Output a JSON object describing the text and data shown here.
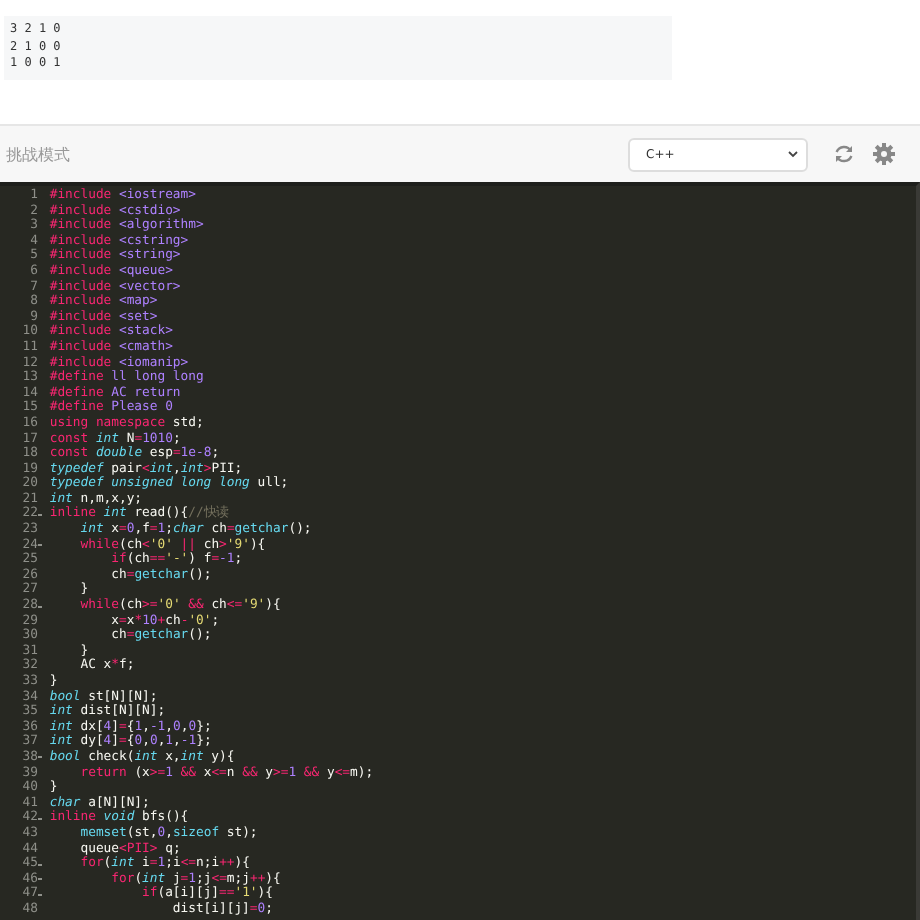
{
  "sample_output": [
    "3 2 1 0",
    "2 1 0 0",
    "1 0 0 1"
  ],
  "toolbar": {
    "mode_label": "挑战模式",
    "language": "C++"
  },
  "editor": {
    "lines": [
      {
        "n": "1",
        "foldable": false,
        "tokens": [
          {
            "kind": "keyword",
            "text": "#include"
          },
          {
            "kind": "literal",
            "text": " <iostream>"
          }
        ]
      },
      {
        "n": "2",
        "foldable": false,
        "tokens": [
          {
            "kind": "keyword",
            "text": "#include"
          },
          {
            "kind": "literal",
            "text": " <cstdio>"
          }
        ]
      },
      {
        "n": "3",
        "foldable": false,
        "tokens": [
          {
            "kind": "keyword",
            "text": "#include"
          },
          {
            "kind": "literal",
            "text": " <algorithm>"
          }
        ]
      },
      {
        "n": "4",
        "foldable": false,
        "tokens": [
          {
            "kind": "keyword",
            "text": "#include"
          },
          {
            "kind": "literal",
            "text": " <cstring>"
          }
        ]
      },
      {
        "n": "5",
        "foldable": false,
        "tokens": [
          {
            "kind": "keyword",
            "text": "#include"
          },
          {
            "kind": "literal",
            "text": " <string>"
          }
        ]
      },
      {
        "n": "6",
        "foldable": false,
        "tokens": [
          {
            "kind": "keyword",
            "text": "#include"
          },
          {
            "kind": "literal",
            "text": " <queue>"
          }
        ]
      },
      {
        "n": "7",
        "foldable": false,
        "tokens": [
          {
            "kind": "keyword",
            "text": "#include"
          },
          {
            "kind": "literal",
            "text": " <vector>"
          }
        ]
      },
      {
        "n": "8",
        "foldable": false,
        "tokens": [
          {
            "kind": "keyword",
            "text": "#include"
          },
          {
            "kind": "literal",
            "text": " <map>"
          }
        ]
      },
      {
        "n": "9",
        "foldable": false,
        "tokens": [
          {
            "kind": "keyword",
            "text": "#include"
          },
          {
            "kind": "literal",
            "text": " <set>"
          }
        ]
      },
      {
        "n": "10",
        "foldable": false,
        "tokens": [
          {
            "kind": "keyword",
            "text": "#include"
          },
          {
            "kind": "literal",
            "text": " <stack>"
          }
        ]
      },
      {
        "n": "11",
        "foldable": false,
        "tokens": [
          {
            "kind": "keyword",
            "text": "#include"
          },
          {
            "kind": "literal",
            "text": " <cmath>"
          }
        ]
      },
      {
        "n": "12",
        "foldable": false,
        "tokens": [
          {
            "kind": "keyword",
            "text": "#include"
          },
          {
            "kind": "literal",
            "text": " <iomanip>"
          }
        ]
      },
      {
        "n": "13",
        "foldable": false,
        "tokens": [
          {
            "kind": "keyword",
            "text": "#define"
          },
          {
            "kind": "macro",
            "text": " ll long long"
          }
        ]
      },
      {
        "n": "14",
        "foldable": false,
        "tokens": [
          {
            "kind": "keyword",
            "text": "#define"
          },
          {
            "kind": "macro",
            "text": " AC return"
          }
        ]
      },
      {
        "n": "15",
        "foldable": false,
        "tokens": [
          {
            "kind": "keyword",
            "text": "#define"
          },
          {
            "kind": "macro",
            "text": " Please 0"
          }
        ]
      },
      {
        "n": "16",
        "foldable": false,
        "tokens": [
          {
            "kind": "keyword",
            "text": "using namespace"
          },
          {
            "kind": "plain",
            "text": " std;"
          }
        ]
      },
      {
        "n": "17",
        "foldable": false,
        "tokens": [
          {
            "kind": "keyword",
            "text": "const"
          },
          {
            "kind": "type",
            "text": " int"
          },
          {
            "kind": "plain",
            "text": " N"
          },
          {
            "kind": "operator",
            "text": "="
          },
          {
            "kind": "literal",
            "text": "1010"
          },
          {
            "kind": "plain",
            "text": ";"
          }
        ]
      },
      {
        "n": "18",
        "foldable": false,
        "tokens": [
          {
            "kind": "keyword",
            "text": "const"
          },
          {
            "kind": "type",
            "text": " double"
          },
          {
            "kind": "plain",
            "text": " esp"
          },
          {
            "kind": "operator",
            "text": "="
          },
          {
            "kind": "literal",
            "text": "1e-8"
          },
          {
            "kind": "plain",
            "text": ";"
          }
        ]
      },
      {
        "n": "19",
        "foldable": false,
        "tokens": [
          {
            "kind": "type",
            "text": "typedef"
          },
          {
            "kind": "plain",
            "text": " pair"
          },
          {
            "kind": "operator",
            "text": "<"
          },
          {
            "kind": "type",
            "text": "int"
          },
          {
            "kind": "plain",
            "text": ","
          },
          {
            "kind": "type",
            "text": "int"
          },
          {
            "kind": "operator",
            "text": ">"
          },
          {
            "kind": "plain",
            "text": "PII;"
          }
        ]
      },
      {
        "n": "20",
        "foldable": false,
        "tokens": [
          {
            "kind": "type",
            "text": "typedef unsigned long long"
          },
          {
            "kind": "plain",
            "text": " ull;"
          }
        ]
      },
      {
        "n": "21",
        "foldable": false,
        "tokens": [
          {
            "kind": "type",
            "text": "int"
          },
          {
            "kind": "plain",
            "text": " n,m,x,y;"
          }
        ]
      },
      {
        "n": "22",
        "foldable": true,
        "tokens": [
          {
            "kind": "keyword",
            "text": "inline"
          },
          {
            "kind": "type",
            "text": " int"
          },
          {
            "kind": "plain",
            "text": " read(){"
          },
          {
            "kind": "comment",
            "text": "//快读"
          }
        ]
      },
      {
        "n": "23",
        "foldable": false,
        "tokens": [
          {
            "kind": "type",
            "text": "    int"
          },
          {
            "kind": "plain",
            "text": " x"
          },
          {
            "kind": "operator",
            "text": "="
          },
          {
            "kind": "literal",
            "text": "0"
          },
          {
            "kind": "plain",
            "text": ",f"
          },
          {
            "kind": "operator",
            "text": "="
          },
          {
            "kind": "literal",
            "text": "1"
          },
          {
            "kind": "plain",
            "text": ";"
          },
          {
            "kind": "type",
            "text": "char"
          },
          {
            "kind": "plain",
            "text": " ch"
          },
          {
            "kind": "operator",
            "text": "="
          },
          {
            "kind": "function",
            "text": "getchar"
          },
          {
            "kind": "plain",
            "text": "();"
          }
        ]
      },
      {
        "n": "24",
        "foldable": true,
        "tokens": [
          {
            "kind": "keyword",
            "text": "    while"
          },
          {
            "kind": "plain",
            "text": "(ch"
          },
          {
            "kind": "operator",
            "text": "<"
          },
          {
            "kind": "string",
            "text": "'0'"
          },
          {
            "kind": "operator",
            "text": " ||"
          },
          {
            "kind": "plain",
            "text": " ch"
          },
          {
            "kind": "operator",
            "text": ">"
          },
          {
            "kind": "string",
            "text": "'9'"
          },
          {
            "kind": "plain",
            "text": "){"
          }
        ]
      },
      {
        "n": "25",
        "foldable": false,
        "tokens": [
          {
            "kind": "keyword",
            "text": "        if"
          },
          {
            "kind": "plain",
            "text": "(ch"
          },
          {
            "kind": "operator",
            "text": "=="
          },
          {
            "kind": "string",
            "text": "'-'"
          },
          {
            "kind": "plain",
            "text": ") f"
          },
          {
            "kind": "operator",
            "text": "="
          },
          {
            "kind": "literal",
            "text": "-1"
          },
          {
            "kind": "plain",
            "text": ";"
          }
        ]
      },
      {
        "n": "26",
        "foldable": false,
        "tokens": [
          {
            "kind": "plain",
            "text": "        ch"
          },
          {
            "kind": "operator",
            "text": "="
          },
          {
            "kind": "function",
            "text": "getchar"
          },
          {
            "kind": "plain",
            "text": "();"
          }
        ]
      },
      {
        "n": "27",
        "foldable": false,
        "tokens": [
          {
            "kind": "plain",
            "text": "    }"
          }
        ]
      },
      {
        "n": "28",
        "foldable": true,
        "tokens": [
          {
            "kind": "keyword",
            "text": "    while"
          },
          {
            "kind": "plain",
            "text": "(ch"
          },
          {
            "kind": "operator",
            "text": ">="
          },
          {
            "kind": "string",
            "text": "'0'"
          },
          {
            "kind": "operator",
            "text": " &&"
          },
          {
            "kind": "plain",
            "text": " ch"
          },
          {
            "kind": "operator",
            "text": "<="
          },
          {
            "kind": "string",
            "text": "'9'"
          },
          {
            "kind": "plain",
            "text": "){"
          }
        ]
      },
      {
        "n": "29",
        "foldable": false,
        "tokens": [
          {
            "kind": "plain",
            "text": "        x"
          },
          {
            "kind": "operator",
            "text": "="
          },
          {
            "kind": "plain",
            "text": "x"
          },
          {
            "kind": "operator",
            "text": "*"
          },
          {
            "kind": "literal",
            "text": "10"
          },
          {
            "kind": "operator",
            "text": "+"
          },
          {
            "kind": "plain",
            "text": "ch"
          },
          {
            "kind": "operator",
            "text": "-"
          },
          {
            "kind": "string",
            "text": "'0'"
          },
          {
            "kind": "plain",
            "text": ";"
          }
        ]
      },
      {
        "n": "30",
        "foldable": false,
        "tokens": [
          {
            "kind": "plain",
            "text": "        ch"
          },
          {
            "kind": "operator",
            "text": "="
          },
          {
            "kind": "function",
            "text": "getchar"
          },
          {
            "kind": "plain",
            "text": "();"
          }
        ]
      },
      {
        "n": "31",
        "foldable": false,
        "tokens": [
          {
            "kind": "plain",
            "text": "    }"
          }
        ]
      },
      {
        "n": "32",
        "foldable": false,
        "tokens": [
          {
            "kind": "plain",
            "text": "    AC x"
          },
          {
            "kind": "operator",
            "text": "*"
          },
          {
            "kind": "plain",
            "text": "f;"
          }
        ]
      },
      {
        "n": "33",
        "foldable": false,
        "tokens": [
          {
            "kind": "plain",
            "text": "}"
          }
        ]
      },
      {
        "n": "34",
        "foldable": false,
        "tokens": [
          {
            "kind": "type",
            "text": "bool"
          },
          {
            "kind": "plain",
            "text": " st[N][N];"
          }
        ]
      },
      {
        "n": "35",
        "foldable": false,
        "tokens": [
          {
            "kind": "type",
            "text": "int"
          },
          {
            "kind": "plain",
            "text": " dist[N][N];"
          }
        ]
      },
      {
        "n": "36",
        "foldable": false,
        "tokens": [
          {
            "kind": "type",
            "text": "int"
          },
          {
            "kind": "plain",
            "text": " dx["
          },
          {
            "kind": "literal",
            "text": "4"
          },
          {
            "kind": "plain",
            "text": "]"
          },
          {
            "kind": "operator",
            "text": "="
          },
          {
            "kind": "plain",
            "text": "{"
          },
          {
            "kind": "literal",
            "text": "1"
          },
          {
            "kind": "plain",
            "text": ","
          },
          {
            "kind": "literal",
            "text": "-1"
          },
          {
            "kind": "plain",
            "text": ","
          },
          {
            "kind": "literal",
            "text": "0"
          },
          {
            "kind": "plain",
            "text": ","
          },
          {
            "kind": "literal",
            "text": "0"
          },
          {
            "kind": "plain",
            "text": "};"
          }
        ]
      },
      {
        "n": "37",
        "foldable": false,
        "tokens": [
          {
            "kind": "type",
            "text": "int"
          },
          {
            "kind": "plain",
            "text": " dy["
          },
          {
            "kind": "literal",
            "text": "4"
          },
          {
            "kind": "plain",
            "text": "]"
          },
          {
            "kind": "operator",
            "text": "="
          },
          {
            "kind": "plain",
            "text": "{"
          },
          {
            "kind": "literal",
            "text": "0"
          },
          {
            "kind": "plain",
            "text": ","
          },
          {
            "kind": "literal",
            "text": "0"
          },
          {
            "kind": "plain",
            "text": ","
          },
          {
            "kind": "literal",
            "text": "1"
          },
          {
            "kind": "plain",
            "text": ","
          },
          {
            "kind": "literal",
            "text": "-1"
          },
          {
            "kind": "plain",
            "text": "};"
          }
        ]
      },
      {
        "n": "38",
        "foldable": true,
        "tokens": [
          {
            "kind": "type",
            "text": "bool"
          },
          {
            "kind": "plain",
            "text": " check("
          },
          {
            "kind": "type",
            "text": "int"
          },
          {
            "kind": "plain",
            "text": " x,"
          },
          {
            "kind": "type",
            "text": "int"
          },
          {
            "kind": "plain",
            "text": " y){"
          }
        ]
      },
      {
        "n": "39",
        "foldable": false,
        "tokens": [
          {
            "kind": "keyword",
            "text": "    return"
          },
          {
            "kind": "plain",
            "text": " (x"
          },
          {
            "kind": "operator",
            "text": ">="
          },
          {
            "kind": "literal",
            "text": "1"
          },
          {
            "kind": "operator",
            "text": " &&"
          },
          {
            "kind": "plain",
            "text": " x"
          },
          {
            "kind": "operator",
            "text": "<="
          },
          {
            "kind": "plain",
            "text": "n"
          },
          {
            "kind": "operator",
            "text": " &&"
          },
          {
            "kind": "plain",
            "text": " y"
          },
          {
            "kind": "operator",
            "text": ">="
          },
          {
            "kind": "literal",
            "text": "1"
          },
          {
            "kind": "operator",
            "text": " &&"
          },
          {
            "kind": "plain",
            "text": " y"
          },
          {
            "kind": "operator",
            "text": "<="
          },
          {
            "kind": "plain",
            "text": "m);"
          }
        ]
      },
      {
        "n": "40",
        "foldable": false,
        "tokens": [
          {
            "kind": "plain",
            "text": "}"
          }
        ]
      },
      {
        "n": "41",
        "foldable": false,
        "tokens": [
          {
            "kind": "type",
            "text": "char"
          },
          {
            "kind": "plain",
            "text": " a[N][N];"
          }
        ]
      },
      {
        "n": "42",
        "foldable": true,
        "tokens": [
          {
            "kind": "keyword",
            "text": "inline"
          },
          {
            "kind": "type",
            "text": " void"
          },
          {
            "kind": "plain",
            "text": " bfs(){"
          }
        ]
      },
      {
        "n": "43",
        "foldable": false,
        "tokens": [
          {
            "kind": "function",
            "text": "    memset"
          },
          {
            "kind": "plain",
            "text": "(st,"
          },
          {
            "kind": "literal",
            "text": "0"
          },
          {
            "kind": "plain",
            "text": ","
          },
          {
            "kind": "function",
            "text": "sizeof"
          },
          {
            "kind": "plain",
            "text": " st);"
          }
        ]
      },
      {
        "n": "44",
        "foldable": false,
        "tokens": [
          {
            "kind": "plain",
            "text": "    queue"
          },
          {
            "kind": "operator",
            "text": "<PII>"
          },
          {
            "kind": "plain",
            "text": " q;"
          }
        ]
      },
      {
        "n": "45",
        "foldable": true,
        "tokens": [
          {
            "kind": "keyword",
            "text": "    for"
          },
          {
            "kind": "plain",
            "text": "("
          },
          {
            "kind": "type",
            "text": "int"
          },
          {
            "kind": "plain",
            "text": " i"
          },
          {
            "kind": "operator",
            "text": "="
          },
          {
            "kind": "literal",
            "text": "1"
          },
          {
            "kind": "plain",
            "text": ";i"
          },
          {
            "kind": "operator",
            "text": "<="
          },
          {
            "kind": "plain",
            "text": "n;i"
          },
          {
            "kind": "operator",
            "text": "++"
          },
          {
            "kind": "plain",
            "text": "){"
          }
        ]
      },
      {
        "n": "46",
        "foldable": true,
        "tokens": [
          {
            "kind": "keyword",
            "text": "        for"
          },
          {
            "kind": "plain",
            "text": "("
          },
          {
            "kind": "type",
            "text": "int"
          },
          {
            "kind": "plain",
            "text": " j"
          },
          {
            "kind": "operator",
            "text": "="
          },
          {
            "kind": "literal",
            "text": "1"
          },
          {
            "kind": "plain",
            "text": ";j"
          },
          {
            "kind": "operator",
            "text": "<="
          },
          {
            "kind": "plain",
            "text": "m;j"
          },
          {
            "kind": "operator",
            "text": "++"
          },
          {
            "kind": "plain",
            "text": "){"
          }
        ]
      },
      {
        "n": "47",
        "foldable": true,
        "tokens": [
          {
            "kind": "keyword",
            "text": "            if"
          },
          {
            "kind": "plain",
            "text": "(a[i][j]"
          },
          {
            "kind": "operator",
            "text": "=="
          },
          {
            "kind": "string",
            "text": "'1'"
          },
          {
            "kind": "plain",
            "text": "){"
          }
        ]
      },
      {
        "n": "48",
        "foldable": false,
        "tokens": [
          {
            "kind": "plain",
            "text": "                dist[i][j]"
          },
          {
            "kind": "operator",
            "text": "="
          },
          {
            "kind": "literal",
            "text": "0"
          },
          {
            "kind": "plain",
            "text": ";"
          }
        ]
      }
    ]
  }
}
